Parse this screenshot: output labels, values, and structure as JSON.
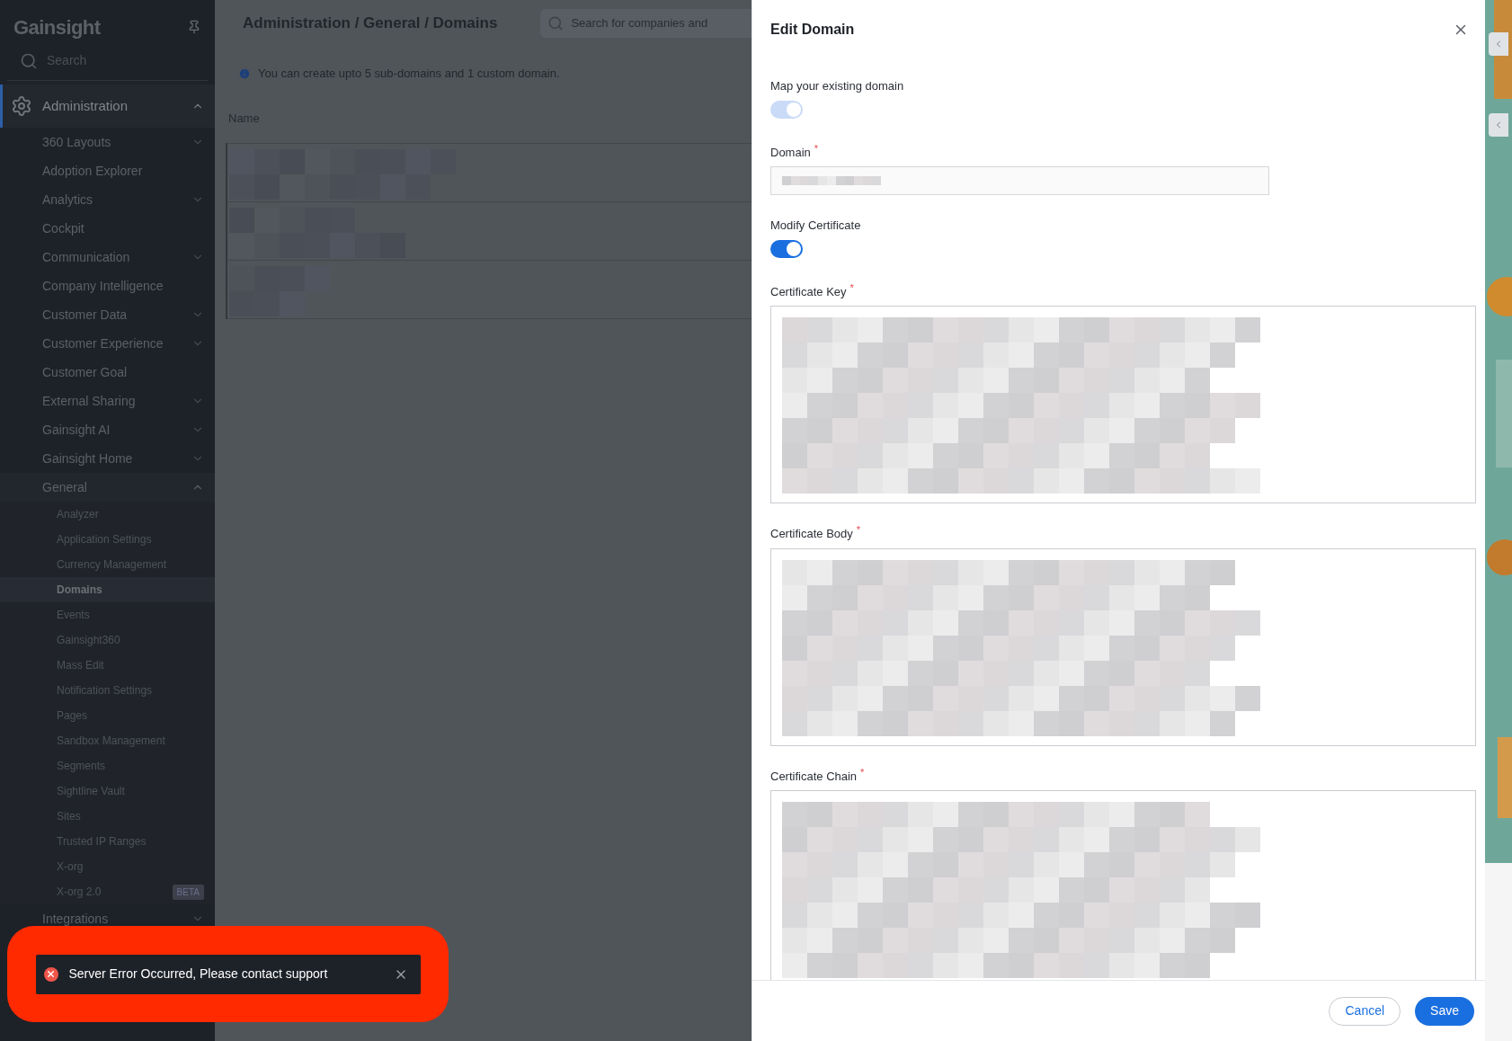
{
  "sidebar": {
    "logo": "Gainsight",
    "search": {
      "placeholder": "Search"
    },
    "section": {
      "label": "Administration",
      "expanded": true,
      "items": [
        {
          "label": "360 Layouts",
          "kind": "group",
          "expanded": false
        },
        {
          "label": "Adoption Explorer",
          "kind": "link"
        },
        {
          "label": "Analytics",
          "kind": "group",
          "expanded": false
        },
        {
          "label": "Cockpit",
          "kind": "link"
        },
        {
          "label": "Communication",
          "kind": "group",
          "expanded": false
        },
        {
          "label": "Company Intelligence",
          "kind": "link"
        },
        {
          "label": "Customer Data",
          "kind": "group",
          "expanded": false
        },
        {
          "label": "Customer Experience",
          "kind": "group",
          "expanded": false
        },
        {
          "label": "Customer Goal",
          "kind": "link"
        },
        {
          "label": "External Sharing",
          "kind": "group",
          "expanded": false
        },
        {
          "label": "Gainsight AI",
          "kind": "group",
          "expanded": false
        },
        {
          "label": "Gainsight Home",
          "kind": "group",
          "expanded": false
        },
        {
          "label": "General",
          "kind": "group",
          "expanded": true,
          "children": [
            {
              "label": "Analyzer",
              "selected": false
            },
            {
              "label": "Application Settings",
              "selected": false
            },
            {
              "label": "Currency Management",
              "selected": false
            },
            {
              "label": "Domains",
              "selected": true
            },
            {
              "label": "Events",
              "selected": false
            },
            {
              "label": "Gainsight360",
              "selected": false
            },
            {
              "label": "Mass Edit",
              "selected": false
            },
            {
              "label": "Notification Settings",
              "selected": false
            },
            {
              "label": "Pages",
              "selected": false
            },
            {
              "label": "Sandbox Management",
              "selected": false
            },
            {
              "label": "Segments",
              "selected": false
            },
            {
              "label": "Sightline Vault",
              "selected": false
            },
            {
              "label": "Sites",
              "selected": false
            },
            {
              "label": "Trusted IP Ranges",
              "selected": false
            },
            {
              "label": "X-org",
              "selected": false
            },
            {
              "label": "X-org 2.0",
              "selected": false,
              "badge": "BETA"
            }
          ]
        },
        {
          "label": "Integrations",
          "kind": "group",
          "expanded": false
        }
      ]
    }
  },
  "main": {
    "breadcrumb": "Administration / General / Domains",
    "search": {
      "placeholder": "Search for companies and"
    },
    "info": "You can create upto 5 sub-domains and 1 custom domain.",
    "table": {
      "columns": [
        "Name"
      ]
    }
  },
  "panel": {
    "title": "Edit Domain",
    "fields": [
      {
        "kind": "toggle",
        "label": "Map your existing domain",
        "on": true,
        "disabled": true
      },
      {
        "kind": "text",
        "label": "Domain",
        "required_mark": "*"
      },
      {
        "kind": "toggle",
        "label": "Modify Certificate",
        "on": true,
        "disabled": false
      },
      {
        "kind": "textarea",
        "label": "Certificate Key",
        "required_mark": "*"
      },
      {
        "kind": "textarea",
        "label": "Certificate Body",
        "required_mark": "*"
      },
      {
        "kind": "textarea",
        "label": "Certificate Chain",
        "required_mark": "*"
      }
    ],
    "buttons": [
      {
        "label": "Cancel",
        "kind": "secondary"
      },
      {
        "label": "Save",
        "kind": "primary"
      }
    ]
  },
  "toast": {
    "kind": "error",
    "message": "Server Error Occurred, Please contact support"
  }
}
